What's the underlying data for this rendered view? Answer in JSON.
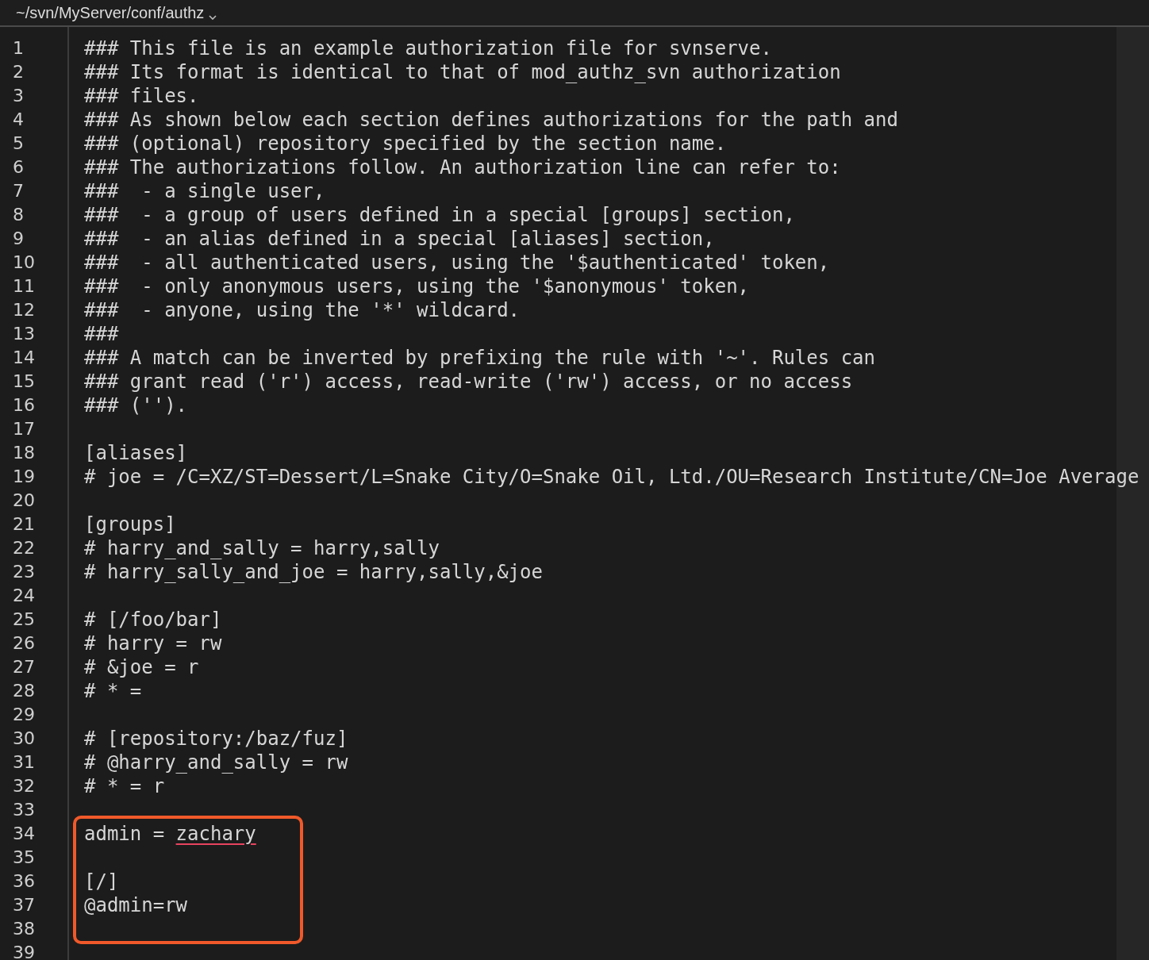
{
  "window": {
    "title": "~/svn/MyServer/conf/authz"
  },
  "editor": {
    "lines": [
      {
        "number": "1",
        "text": "### This file is an example authorization file for svnserve.",
        "highlighted": false
      },
      {
        "number": "2",
        "text": "### Its format is identical to that of mod_authz_svn authorization",
        "highlighted": false
      },
      {
        "number": "3",
        "text": "### files.",
        "highlighted": false
      },
      {
        "number": "4",
        "text": "### As shown below each section defines authorizations for the path and",
        "highlighted": false
      },
      {
        "number": "5",
        "text": "### (optional) repository specified by the section name.",
        "highlighted": false
      },
      {
        "number": "6",
        "text": "### The authorizations follow. An authorization line can refer to:",
        "highlighted": false
      },
      {
        "number": "7",
        "text": "###  - a single user,",
        "highlighted": false
      },
      {
        "number": "8",
        "text": "###  - a group of users defined in a special [groups] section,",
        "highlighted": false
      },
      {
        "number": "9",
        "text": "###  - an alias defined in a special [aliases] section,",
        "highlighted": false
      },
      {
        "number": "10",
        "text": "###  - all authenticated users, using the '$authenticated' token,",
        "highlighted": false
      },
      {
        "number": "11",
        "text": "###  - only anonymous users, using the '$anonymous' token,",
        "highlighted": false
      },
      {
        "number": "12",
        "text": "###  - anyone, using the '*' wildcard.",
        "highlighted": false
      },
      {
        "number": "13",
        "text": "###",
        "highlighted": false
      },
      {
        "number": "14",
        "text": "### A match can be inverted by prefixing the rule with '~'. Rules can",
        "highlighted": false
      },
      {
        "number": "15",
        "text": "### grant read ('r') access, read-write ('rw') access, or no access",
        "highlighted": false
      },
      {
        "number": "16",
        "text": "### ('').",
        "highlighted": false
      },
      {
        "number": "17",
        "highlighted": false
      },
      {
        "number": "18",
        "text": "[aliases]",
        "highlighted": false
      },
      {
        "number": "19",
        "text": "# joe = /C=XZ/ST=Dessert/L=Snake City/O=Snake Oil, Ltd./OU=Research Institute/CN=Joe Average",
        "highlighted": false
      },
      {
        "number": "20",
        "highlighted": false
      },
      {
        "number": "21",
        "text": "[groups]",
        "highlighted": false
      },
      {
        "number": "22",
        "text": "# harry_and_sally = harry,sally",
        "highlighted": false
      },
      {
        "number": "23",
        "text": "# harry_sally_and_joe = harry,sally,&joe",
        "highlighted": false
      },
      {
        "number": "24",
        "highlighted": false
      },
      {
        "number": "25",
        "text": "# [/foo/bar]",
        "highlighted": false
      },
      {
        "number": "26",
        "text": "# harry = rw",
        "highlighted": false
      },
      {
        "number": "27",
        "text": "# &joe = r",
        "highlighted": false
      },
      {
        "number": "28",
        "text": "# * =",
        "highlighted": false
      },
      {
        "number": "29",
        "highlighted": false
      },
      {
        "number": "30",
        "text": "# [repository:/baz/fuz]",
        "highlighted": false
      },
      {
        "number": "31",
        "text": "# @harry_and_sally = rw",
        "highlighted": false
      },
      {
        "number": "32",
        "text": "# * = r",
        "highlighted": false
      },
      {
        "number": "33",
        "highlighted": false
      },
      {
        "number": "34",
        "segments": [
          {
            "text": "admin = ",
            "misspelled": false
          },
          {
            "text": "zachary",
            "misspelled": true
          }
        ],
        "highlighted": true
      },
      {
        "number": "35",
        "highlighted": true
      },
      {
        "number": "36",
        "text": "[/]",
        "highlighted": true
      },
      {
        "number": "37",
        "text": "@admin=rw",
        "highlighted": true
      },
      {
        "number": "38",
        "highlighted": true
      },
      {
        "number": "39",
        "highlighted": false
      }
    ]
  }
}
